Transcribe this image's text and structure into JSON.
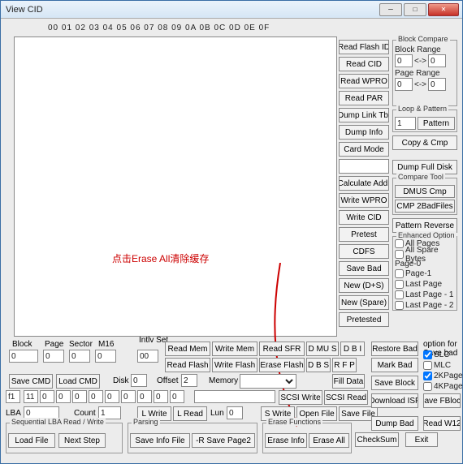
{
  "window": {
    "title": "View CID"
  },
  "hex_header": "00  01  02  03  04  05  06  07  08  09  0A  0B  0C  0D  0E  0F",
  "annotation": "点击Erase All清除缓存",
  "mid_buttons": {
    "read_flash_id": "Read Flash ID",
    "read_cid": "Read CID",
    "read_wpro": "Read WPRO",
    "read_par": "Read PAR",
    "dump_link_tbl": "Dump Link Tbl",
    "dump_info": "Dump Info",
    "card_mode": "Card Mode",
    "calculate_addr": "Calculate Addr",
    "write_wpro": "Write WPRO",
    "write_cid": "Write CID",
    "pretest": "Pretest",
    "cdfs": "CDFS",
    "save_bad": "Save Bad",
    "new_ds": "New (D+S)",
    "new_spare": "New (Spare)",
    "pretested": "Pretested",
    "restore_bad": "Restore Bad",
    "mark_bad": "Mark Bad",
    "save_block": "Save Block",
    "download_isp": "Download ISP",
    "dump_bad": "Dump Bad",
    "exit": "Exit"
  },
  "right_panel": {
    "block_compare": "Block Compare",
    "block_range": "Block Range",
    "page_range": "Page Range",
    "loop_pattern": "Loop & Pattern",
    "pattern": "Pattern",
    "copy_cmp": "Copy & Cmp",
    "dump_full_disk": "Dump Full Disk",
    "compare_tool": "Compare Tool",
    "dmus_cmp": "DMUS Cmp",
    "cmp_2badfiles": "CMP 2BadFiles",
    "pattern_reverse": "Pattern Reverse",
    "enhanced_option": "Enhanced Option",
    "all_pages": "All Pages",
    "all_spare_bytes": "All Spare Bytes",
    "page0": "Page-0",
    "page1": "Page-1",
    "last_page": "Last Page",
    "last_page_1": "Last Page - 1",
    "last_page_2": "Last Page - 2",
    "save_bad_opt": "option for Save bad",
    "slc": "SLC",
    "mlc": "MLC",
    "k2page": "2KPage",
    "k4page": "4KPage",
    "save_fblock": "Save FBlock",
    "read_w12": "Read W12"
  },
  "values": {
    "zero": "0",
    "one": "1",
    "two": "2",
    "arrow": "<->",
    "intlv": "00",
    "memory": ""
  },
  "lower": {
    "block": "Block",
    "page": "Page",
    "sector": "Sector",
    "m16": "M16",
    "intlv_set": "Intlv Set",
    "read_mem": "Read Mem",
    "write_mem": "Write Mem",
    "read_sfr": "Read SFR",
    "dmus": "D MU S",
    "dbi": "D B I",
    "read_flash": "Read Flash",
    "write_flash": "Write Flash",
    "erase_flash": "Erase Flash",
    "dbs": "D B S",
    "rfp": "R F P",
    "save_cmd": "Save CMD",
    "load_cmd": "Load CMD",
    "disk": "Disk",
    "offset": "Offset",
    "memory": "Memory",
    "fill_data": "Fill Data",
    "f1": "f1",
    "scsi_write": "SCSI Write",
    "scsi_read": "SCSI Read",
    "lba": "LBA",
    "count": "Count",
    "lwrite": "L Write",
    "lread": "L Read",
    "lun": "Lun",
    "swrite": "S Write",
    "open_file": "Open File",
    "save_file": "Save File",
    "seq_title": "Sequential LBA Read / Write",
    "load_file": "Load File",
    "next_step": "Next Step",
    "parsing": "Parsing",
    "save_info_file": "Save Info File",
    "r_save_page2": "-R Save Page2",
    "erase_functions": "Erase Functions",
    "erase_info": "Erase Info",
    "erase_all": "Erase All",
    "checksum": "CheckSum",
    "row2_vals": [
      "11",
      "0",
      "0",
      "0",
      "0",
      "0",
      "0",
      "0",
      "0",
      "0"
    ]
  }
}
